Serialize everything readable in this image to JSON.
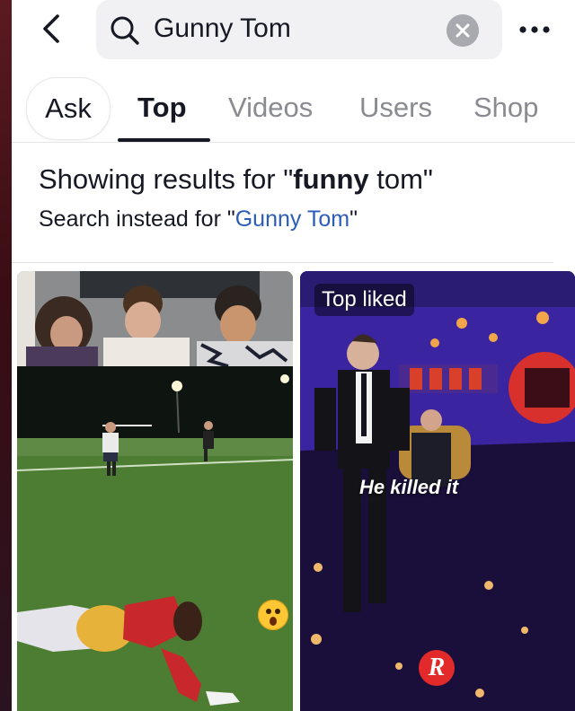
{
  "search": {
    "query": "Gunny Tom"
  },
  "tabs": [
    {
      "label": "Ask"
    },
    {
      "label": "Top"
    },
    {
      "label": "Videos"
    },
    {
      "label": "Users"
    },
    {
      "label": "Shop"
    }
  ],
  "correction": {
    "showing_prefix": "Showing results for \"",
    "showing_term": "funny",
    "showing_suffix": " tom\"",
    "instead_prefix": "Search instead for \"",
    "instead_link": "Gunny Tom",
    "instead_suffix": "\""
  },
  "results": [
    {
      "badge": "",
      "caption": ""
    },
    {
      "badge": "Top liked",
      "caption": "He killed it",
      "logo_letter": "R"
    }
  ],
  "colors": {
    "link": "#2b5db8",
    "text": "#161823",
    "muted": "#8a8b91"
  }
}
